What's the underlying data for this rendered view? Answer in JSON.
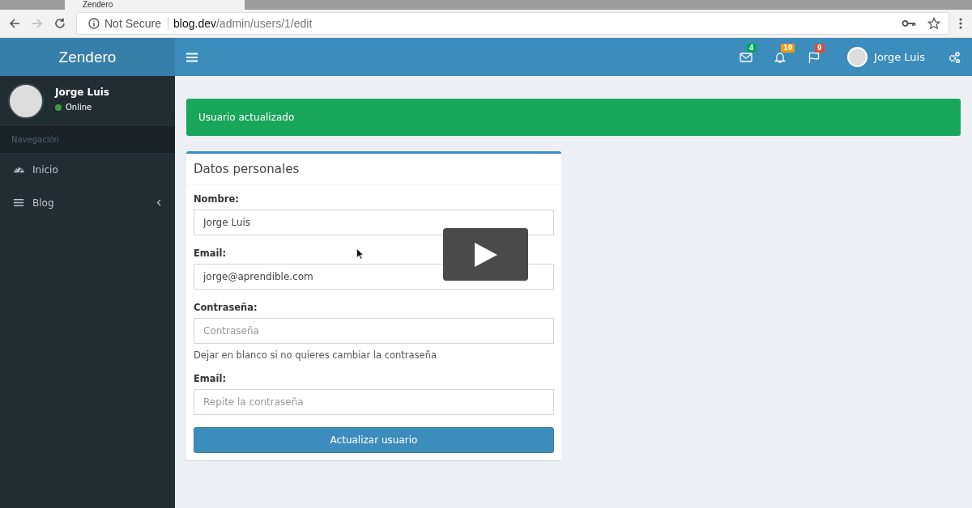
{
  "browser": {
    "tab_title": "Zendero",
    "security": "Not Secure",
    "url_host": "blog.dev",
    "url_path": "/admin/users/1/edit"
  },
  "header": {
    "logo": "Zendero",
    "notifications": [
      {
        "kind": "mail",
        "count": "4",
        "color": "#00a65a"
      },
      {
        "kind": "bell",
        "count": "10",
        "color": "#f39c12"
      },
      {
        "kind": "flag",
        "count": "9",
        "color": "#dd4b39"
      }
    ],
    "user_name": "Jorge Luis"
  },
  "sidebar": {
    "user": {
      "name": "Jorge Luis",
      "status": "Online",
      "color": "#3c9d3f"
    },
    "section": "Navegación",
    "items": [
      {
        "kind": "dashboard",
        "label": "Inicio",
        "expandable": false
      },
      {
        "kind": "list",
        "label": "Blog",
        "expandable": true
      }
    ]
  },
  "alert": {
    "kind": "success",
    "text": "Usuario actualizado"
  },
  "form": {
    "title": "Datos personales",
    "fields": [
      {
        "label": "Nombre:",
        "value": "Jorge Luis"
      },
      {
        "label": "Email:",
        "value": "jorge@aprendible.com"
      },
      {
        "label": "Contraseña:",
        "placeholder": "Contraseña",
        "help": "Dejar en blanco si no quieres cambiar la contraseña"
      },
      {
        "label": "Email:",
        "placeholder": "Repite la contraseña"
      }
    ],
    "submit": "Actualizar usuario"
  },
  "video": {
    "play_button": true
  }
}
